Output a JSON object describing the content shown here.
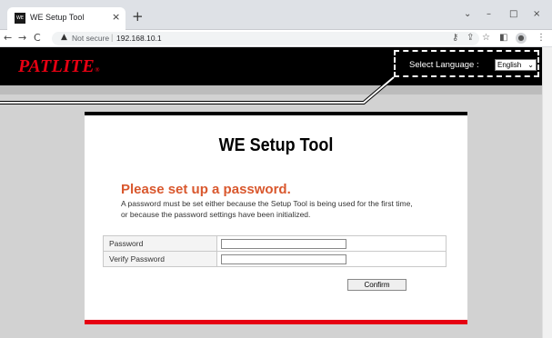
{
  "browser": {
    "tab_title": "WE Setup Tool",
    "favicon_text": "WE",
    "tab_close": "×",
    "new_tab": "+",
    "win_minimize": "–",
    "win_maximize": "□",
    "win_close": "×",
    "win_menu": "⌄",
    "nav_back": "←",
    "nav_forward": "→",
    "nav_reload": "C",
    "warning_icon": "▲",
    "not_secure": "Not secure",
    "url": "192.168.10.1",
    "toolbar_icons": [
      "key-icon",
      "share-icon",
      "star-icon",
      "sidepanel-icon",
      "profile-icon",
      "menu-icon"
    ]
  },
  "header": {
    "logo": "PATLITE",
    "logo_mark": "®",
    "language_label": "Select Language :",
    "language_value": "English"
  },
  "card": {
    "title": "WE Setup Tool",
    "heading": "Please set up a password.",
    "desc_line1": "A password must be set either because the Setup Tool is being used for the first time,",
    "desc_line2": "or because the password settings have been initialized.",
    "password_label": "Password",
    "verify_label": "Verify Password",
    "password_value": "",
    "verify_value": "",
    "confirm_label": "Confirm"
  },
  "colors": {
    "brand_red": "#e60012",
    "heading_orange": "#d9582e",
    "header_bg": "#000000",
    "body_bg": "#d2d2d2"
  }
}
